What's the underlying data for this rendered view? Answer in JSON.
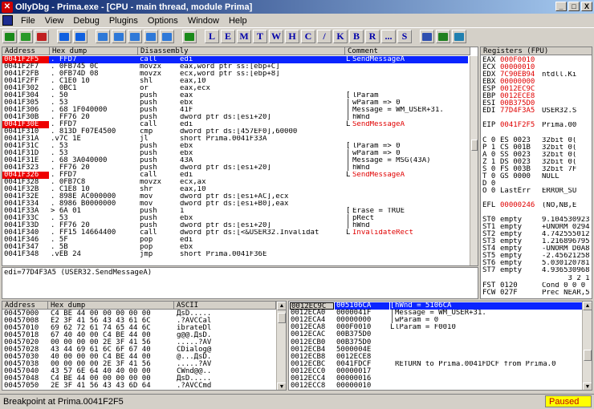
{
  "window": {
    "title": "OllyDbg - Prima.exe - [CPU - main thread, module Prima]",
    "ctrl_min": "_",
    "ctrl_max": "□",
    "ctrl_close": "X"
  },
  "menu": [
    "File",
    "View",
    "Debug",
    "Plugins",
    "Options",
    "Window",
    "Help"
  ],
  "toolbar": {
    "letters": [
      "L",
      "E",
      "M",
      "T",
      "W",
      "H",
      "C",
      "/",
      "K",
      "B",
      "R",
      "...",
      "S"
    ]
  },
  "disasm": {
    "headers": [
      "Address",
      "Hex dump",
      "Disassembly",
      "Comment"
    ],
    "rows": [
      {
        "a": "0041F2F5",
        "h": ". FFD7",
        "d": "call",
        "o": "edi",
        "c": "SendMessageA",
        "sel": true,
        "ared": true,
        "cred": true,
        "br": "L"
      },
      {
        "a": "0041F2F7",
        "h": ". 0FB745 0C",
        "d": "movzx",
        "o": "eax,word ptr ss:[ebp+C]",
        "c": ""
      },
      {
        "a": "0041F2FB",
        "h": ". 0FB74D 08",
        "d": "movzx",
        "o": "ecx,word ptr ss:[ebp+8]",
        "c": ""
      },
      {
        "a": "0041F2FF",
        "h": ". C1E0 10",
        "d": "shl",
        "o": "eax,10",
        "c": ""
      },
      {
        "a": "0041F302",
        "h": ". 0BC1",
        "d": "or",
        "o": "eax,ecx",
        "c": ""
      },
      {
        "a": "0041F304",
        "h": ". 50",
        "d": "push",
        "o": "eax",
        "c": "lParam",
        "br": "["
      },
      {
        "a": "0041F305",
        "h": ". 53",
        "d": "push",
        "o": "ebx",
        "c": "wParam => 0",
        "br": "|"
      },
      {
        "a": "0041F306",
        "h": ". 68 1F040000",
        "d": "push",
        "o": "41F",
        "c": "Message = WM_USER+31.",
        "br": "|"
      },
      {
        "a": "0041F30B",
        "h": ". FF76 20",
        "d": "push",
        "o": "dword ptr ds:[esi+20]",
        "c": "hWnd",
        "br": "|"
      },
      {
        "a": "0041F30E",
        "h": ". FFD7",
        "d": "call",
        "o": "edi",
        "c": "SendMessageA",
        "ared": true,
        "cred": true,
        "br": "L"
      },
      {
        "a": "0041F310",
        "h": ". 813D F07E4500",
        "d": "cmp",
        "o": "dword ptr ds:[457EF0],60000",
        "c": ""
      },
      {
        "a": "0041F31A",
        "h": ".v7C 1E",
        "d": "jl",
        "o": "short Prima.0041F33A",
        "c": ""
      },
      {
        "a": "0041F31C",
        "h": ". 53",
        "d": "push",
        "o": "ebx",
        "c": "lParam => 0",
        "br": "["
      },
      {
        "a": "0041F31D",
        "h": ". 53",
        "d": "push",
        "o": "ebx",
        "c": "wParam => 0",
        "br": "|"
      },
      {
        "a": "0041F31E",
        "h": ". 68 3A040000",
        "d": "push",
        "o": "43A",
        "c": "Message = MSG(43A)",
        "br": "|"
      },
      {
        "a": "0041F323",
        "h": ". FF76 20",
        "d": "push",
        "o": "dword ptr ds:[esi+20]",
        "c": "hWnd",
        "br": "|"
      },
      {
        "a": "0041F326",
        "h": ". FFD7",
        "d": "call",
        "o": "edi",
        "c": "SendMessageA",
        "ared": true,
        "cred": true,
        "br": "L"
      },
      {
        "a": "0041F328",
        "h": ". 0FB7C8",
        "d": "movzx",
        "o": "ecx,ax",
        "c": ""
      },
      {
        "a": "0041F32B",
        "h": ". C1E8 10",
        "d": "shr",
        "o": "eax,10",
        "c": ""
      },
      {
        "a": "0041F32E",
        "h": ". 898E AC000000",
        "d": "mov",
        "o": "dword ptr ds:[esi+AC],ecx",
        "c": ""
      },
      {
        "a": "0041F334",
        "h": ". 8986 B0000000",
        "d": "mov",
        "o": "dword ptr ds:[esi+B0],eax",
        "c": ""
      },
      {
        "a": "0041F33A",
        "h": "> 6A 01",
        "d": "push",
        "o": "1",
        "c": "Erase = TRUE",
        "br": "["
      },
      {
        "a": "0041F33C",
        "h": ". 53",
        "d": "push",
        "o": "ebx",
        "c": "pRect",
        "br": "|"
      },
      {
        "a": "0041F33D",
        "h": ". FF76 20",
        "d": "push",
        "o": "dword ptr ds:[esi+20]",
        "c": "hWnd",
        "br": "|"
      },
      {
        "a": "0041F340",
        "h": ". FF15 14664400",
        "d": "call",
        "o": "dword ptr ds:[<&USER32.Invalidat",
        "c": "InvalidateRect",
        "cred": true,
        "br": "L"
      },
      {
        "a": "0041F346",
        "h": ". 5F",
        "d": "pop",
        "o": "edi",
        "c": ""
      },
      {
        "a": "0041F347",
        "h": ". 5B",
        "d": "pop",
        "o": "ebx",
        "c": ""
      },
      {
        "a": "0041F348",
        "h": ".vEB 24",
        "d": "jmp",
        "o": "short Prima.0041F36E",
        "c": ""
      }
    ]
  },
  "info": {
    "line": "edi=77D4F3A5 (USER32.SendMessageA)"
  },
  "registers": {
    "header": "Registers (FPU)",
    "lines": [
      {
        "n": "EAX",
        "v": "000F0010",
        "r": "",
        "red": true
      },
      {
        "n": "ECX",
        "v": "00000010",
        "r": "",
        "red": true
      },
      {
        "n": "EDX",
        "v": "7C90EB94",
        "r": "ntdll.Ki",
        "red": true
      },
      {
        "n": "EBX",
        "v": "00000000",
        "r": "",
        "red": true
      },
      {
        "n": "ESP",
        "v": "0012EC9C",
        "r": "",
        "red": true
      },
      {
        "n": "EBP",
        "v": "0012ECE8",
        "r": "",
        "red": true
      },
      {
        "n": "ESI",
        "v": "00B375D0",
        "r": "",
        "red": true
      },
      {
        "n": "EDI",
        "v": "77D4F3A5",
        "r": "USER32.S",
        "red": true
      },
      {
        "n": "",
        "v": "",
        "r": ""
      },
      {
        "n": "EIP",
        "v": "0041F2F5",
        "r": "Prima.00",
        "red": true
      },
      {
        "n": "",
        "v": "",
        "r": ""
      },
      {
        "n": "C 0",
        "v": "ES 0023",
        "r": "32bit 0(",
        "red": false
      },
      {
        "n": "P 1",
        "v": "CS 001B",
        "r": "32bit 0(",
        "red": false
      },
      {
        "n": "A 0",
        "v": "SS 0023",
        "r": "32bit 0(",
        "red": false
      },
      {
        "n": "Z 1",
        "v": "DS 0023",
        "r": "32bit 0(",
        "red": false
      },
      {
        "n": "S 0",
        "v": "FS 003B",
        "r": "32bit 7F",
        "red": false
      },
      {
        "n": "T 0",
        "v": "GS 0000",
        "r": "NULL",
        "red": false
      },
      {
        "n": "D 0",
        "v": "",
        "r": ""
      },
      {
        "n": "O 0",
        "v": "LastErr",
        "r": "ERROR_SU",
        "red": false
      },
      {
        "n": "",
        "v": "",
        "r": ""
      },
      {
        "n": "EFL",
        "v": "00000246",
        "r": "(NO,NB,E",
        "red": true
      },
      {
        "n": "",
        "v": "",
        "r": ""
      },
      {
        "n": "ST0",
        "v": "empty",
        "r": "9.104530923",
        "red": false
      },
      {
        "n": "ST1",
        "v": "empty",
        "r": "+UNORM 0294",
        "red": false
      },
      {
        "n": "ST2",
        "v": "empty",
        "r": "4.742555012",
        "red": false
      },
      {
        "n": "ST3",
        "v": "empty",
        "r": "1.216896795",
        "red": false
      },
      {
        "n": "ST4",
        "v": "empty",
        "r": "-UNORM D0A8",
        "red": false
      },
      {
        "n": "ST5",
        "v": "empty",
        "r": "-2.45621258",
        "red": false
      },
      {
        "n": "ST6",
        "v": "empty",
        "r": "5.030120781",
        "red": false
      },
      {
        "n": "ST7",
        "v": "empty",
        "r": "4.936530968",
        "red": false
      },
      {
        "n": "",
        "v": "",
        "r": "      3 2 1"
      },
      {
        "n": "FST",
        "v": "0120",
        "r": "Cond 0 0 0",
        "red": false
      },
      {
        "n": "FCW",
        "v": "027F",
        "r": "Prec NEAR,5",
        "red": false
      }
    ]
  },
  "dump": {
    "headers": [
      "Address",
      "Hex dump",
      "ASCII"
    ],
    "rows": [
      {
        "a": "00457000",
        "h": "C4 BE 44 00 00 00 00 00",
        "s": "ДsD....."
      },
      {
        "a": "00457008",
        "h": "E2 3F 41 56 43 43 61 6C",
        "s": ".?AVCCal"
      },
      {
        "a": "00457010",
        "h": "69 62 72 61 74 65 44 6C",
        "s": "ibrateDl"
      },
      {
        "a": "00457018",
        "h": "67 40 40 00 C4 BE 44 00",
        "s": "g@@.ДsD."
      },
      {
        "a": "00457020",
        "h": "00 00 00 00 2E 3F 41 56",
        "s": ".....?AV"
      },
      {
        "a": "00457028",
        "h": "43 44 69 61 6C 6F 67 40",
        "s": "CDialog@"
      },
      {
        "a": "00457030",
        "h": "40 00 00 00 C4 BE 44 00",
        "s": "@...ДsD."
      },
      {
        "a": "00457038",
        "h": "00 00 00 00 2E 3F 41 56",
        "s": ".....?AV"
      },
      {
        "a": "00457040",
        "h": "43 57 6E 64 40 40 00 00",
        "s": "CWnd@@.."
      },
      {
        "a": "00457048",
        "h": "C4 BE 44 00 00 00 00 00",
        "s": "ДsD....."
      },
      {
        "a": "00457050",
        "h": "2E 3F 41 56 43 43 6D 64",
        "s": ".?AVCCmd"
      }
    ]
  },
  "stack": {
    "rows": [
      {
        "a": "0012EC9C",
        "v": "005106CA",
        "c": "hWnd = 5106CA",
        "sel": true,
        "br": "["
      },
      {
        "a": "0012ECA0",
        "v": "0000041F",
        "c": "Message = WM_USER+31.",
        "br": "|"
      },
      {
        "a": "0012ECA4",
        "v": "00000000",
        "c": "wParam = 0",
        "br": "|"
      },
      {
        "a": "0012ECA8",
        "v": "000F0010",
        "c": "lParam = F0010",
        "br": "L"
      },
      {
        "a": "0012ECAC",
        "v": "00B375D0",
        "c": ""
      },
      {
        "a": "0012ECB0",
        "v": "00B375D0",
        "c": ""
      },
      {
        "a": "0012ECB4",
        "v": "5000004E",
        "c": ""
      },
      {
        "a": "0012ECB8",
        "v": "0012ECE8",
        "c": ""
      },
      {
        "a": "0012ECBC",
        "v": "0041FDCF",
        "c": "RETURN to Prima.0041FDCF from Prima.0"
      },
      {
        "a": "0012ECC0",
        "v": "00000017",
        "c": ""
      },
      {
        "a": "0012ECC4",
        "v": "00000016",
        "c": ""
      },
      {
        "a": "0012ECC8",
        "v": "00000010",
        "c": ""
      }
    ]
  },
  "status": {
    "text": "Breakpoint at Prima.0041F2F5",
    "state": "Paused"
  },
  "colors": {
    "selection": "#0a24ff",
    "breakpoint": "#e00000",
    "title_start": "#0a246a",
    "title_end": "#a6caf0",
    "paused_bg": "#ffff00"
  }
}
